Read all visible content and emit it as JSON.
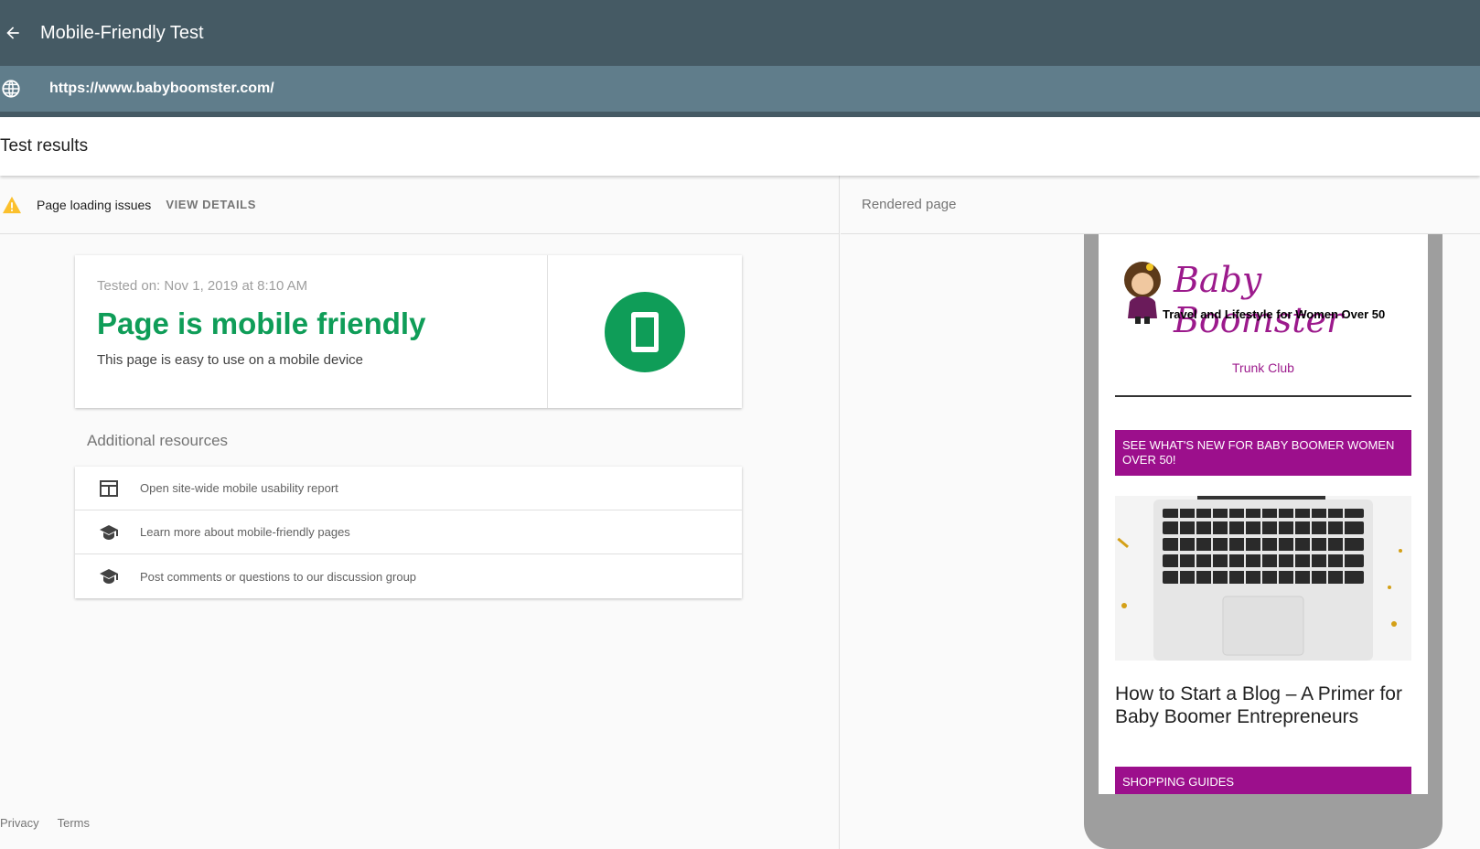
{
  "header": {
    "title": "Mobile-Friendly Test"
  },
  "url_bar": {
    "url": "https://www.babyboomster.com/"
  },
  "results": {
    "title": "Test results"
  },
  "issues": {
    "label": "Page loading issues",
    "details_label": "VIEW DETAILS"
  },
  "summary": {
    "tested_on": "Tested on: Nov 1, 2019 at 8:10 AM",
    "headline": "Page is mobile friendly",
    "subtext": "This page is easy to use on a mobile device"
  },
  "additional": {
    "title": "Additional resources",
    "items": [
      {
        "label": "Open site-wide mobile usability report",
        "icon": "dashboard-icon"
      },
      {
        "label": "Learn more about mobile-friendly pages",
        "icon": "school-icon"
      },
      {
        "label": "Post comments or questions to our discussion group",
        "icon": "school-icon"
      }
    ]
  },
  "footer": {
    "privacy": "Privacy",
    "terms": "Terms"
  },
  "rendered": {
    "title": "Rendered page",
    "site_name": "Baby Boomster",
    "tagline": "Travel and Lifestyle for Women Over 50",
    "image_alt": "Trunk Club",
    "promo": "SEE WHAT'S NEW FOR BABY BOOMER WOMEN OVER 50!",
    "post_title": "How to Start a Blog – A Primer for Baby Boomer Entrepreneurs",
    "shopping": "SHOPPING GUIDES"
  },
  "colors": {
    "topbar": "#455a64",
    "urlbar": "#607d8b",
    "success": "#0f9d58",
    "warning": "#fbc02d",
    "brand": "#9c0f8c"
  }
}
